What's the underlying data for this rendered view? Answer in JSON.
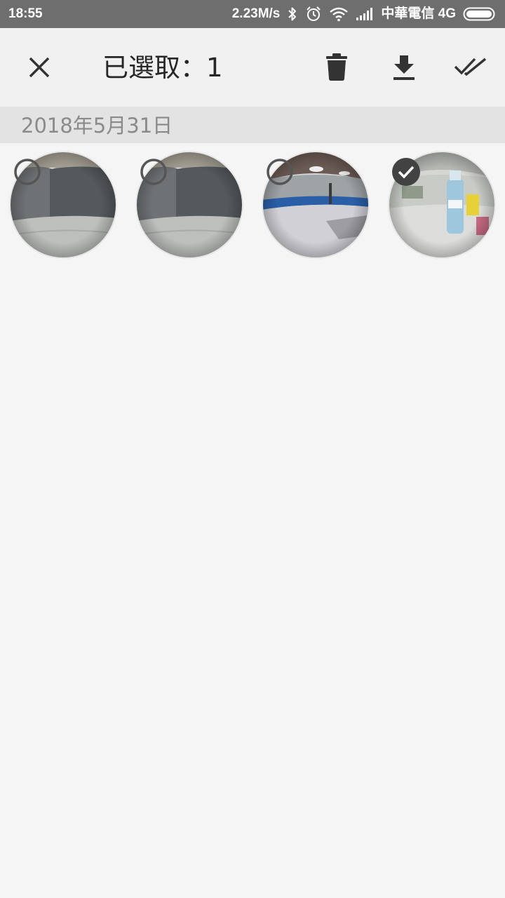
{
  "status_bar": {
    "time": "18:55",
    "net_speed": "2.23M/s",
    "carrier": "中華電信 4G",
    "icons": [
      "bluetooth-icon",
      "alarm-icon",
      "wifi-icon",
      "signal-icon",
      "battery-icon"
    ]
  },
  "toolbar": {
    "title": "已選取：1",
    "icons": [
      "close-icon",
      "delete-icon",
      "download-icon",
      "select-all-icon"
    ]
  },
  "gallery": {
    "date": "2018年5月31日",
    "items": [
      {
        "selected": false,
        "scene": "gray-room-fisheye"
      },
      {
        "selected": false,
        "scene": "gray-room-fisheye"
      },
      {
        "selected": false,
        "scene": "blue-counter-room-fisheye"
      },
      {
        "selected": true,
        "scene": "bottle-table-fisheye"
      }
    ]
  },
  "colors": {
    "status_bar_bg": "#6e6e6e",
    "toolbar_bg": "#f1f1f1",
    "date_header_bg": "#e3e3e3",
    "page_bg": "#f5f5f5",
    "selected_check_bg": "#424242"
  }
}
